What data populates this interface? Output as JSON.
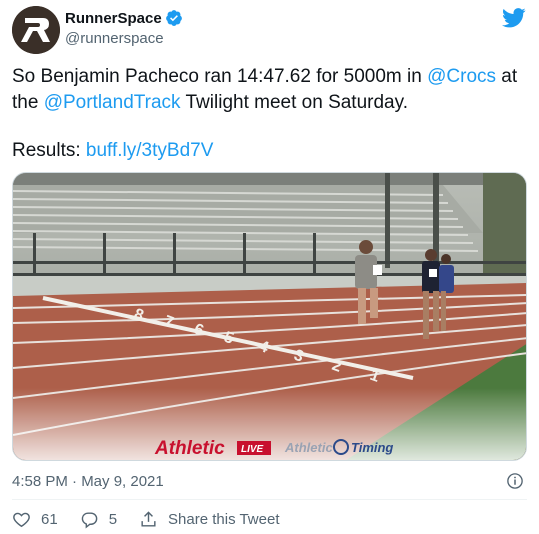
{
  "account": {
    "display_name": "RunnerSpace",
    "handle": "@runnerspace",
    "avatar_icon": "runnerspace-logo-icon",
    "verified_icon": "verified-badge-icon"
  },
  "brand_icon": "twitter-bird-icon",
  "tweet": {
    "text_part1": "So Benjamin Pacheco ran 14:47.62 for 5000m in ",
    "mention1": "@Crocs",
    "text_part2": " at the ",
    "mention2": "@PortlandTrack",
    "text_part3": " Twilight meet on Saturday.",
    "results_label": "Results: ",
    "results_link": "buff.ly/3tyBd7V"
  },
  "media": {
    "overlay_brand1": "Athletic",
    "overlay_brand1_tag": "LIVE",
    "overlay_brand2_a": "Athletic",
    "overlay_brand2_b": "Timing",
    "bibs": [
      "7",
      "7",
      "8"
    ]
  },
  "meta": {
    "timestamp": "4:58 PM · May 9, 2021",
    "info_icon": "info-icon"
  },
  "actions": {
    "like_count": "61",
    "reply_count": "5",
    "share_label": "Share this Tweet"
  },
  "colors": {
    "link": "#1d9bf0",
    "secondary": "#536471",
    "track": "#b0614a"
  }
}
